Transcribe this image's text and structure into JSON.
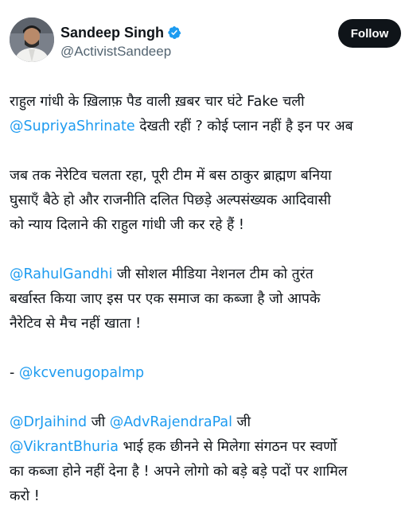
{
  "author": {
    "display_name": "Sandeep Singh",
    "handle": "@ActivistSandeep",
    "verified_icon": "verified-badge-icon",
    "avatar_icon": "avatar"
  },
  "follow_button": {
    "label": "Follow"
  },
  "colors": {
    "link": "#1d9bf0",
    "text": "#0f1419",
    "secondary": "#536471",
    "follow_bg": "#0f1419"
  },
  "tweet": {
    "p1": {
      "l1": "राहुल गांधी के ख़िलाफ़ पैड वाली ख़बर चार घंटे Fake चली",
      "l2_mention": "@SupriyaShrinate",
      "l2_text": " देखती रहीं ? कोई प्लान नहीं है इन पर अब"
    },
    "p2": {
      "l1": "जब तक नेरेटिव चलता रहा, पूरी टीम में बस ठाकुर ब्राह्मण बनिया",
      "l2": "घुसाएँ बैठे हो और राजनीति दलित पिछड़े अल्पसंख्यक आदिवासी",
      "l3": "को न्याय दिलाने की राहुल गांधी जी कर रहे हैं !"
    },
    "p3": {
      "l1_mention": "@RahulGandhi",
      "l1_text": " जी सोशल मीडिया नेशनल टीम को तुरंत",
      "l2": "बर्खास्त किया जाए इस पर एक समाज का कब्जा है जो आपके",
      "l3": "नैरेटिव से मैच नहीं खाता !"
    },
    "p4": {
      "prefix": "- ",
      "mention": "@kcvenugopalmp"
    },
    "p5": {
      "l1_mention1": "@DrJaihind",
      "l1_text1": " जी ",
      "l1_mention2": "@AdvRajendraPal",
      "l1_text2": " जी",
      "l2_mention": "@VikrantBhuria",
      "l2_text": " भाई हक छीनने से मिलेगा संगठन पर स्वर्णो",
      "l3": "का कब्जा होने नहीं देना है ! अपने लोगो को बड़े बड़े पदों पर शामिल",
      "l4": "करो !"
    }
  }
}
